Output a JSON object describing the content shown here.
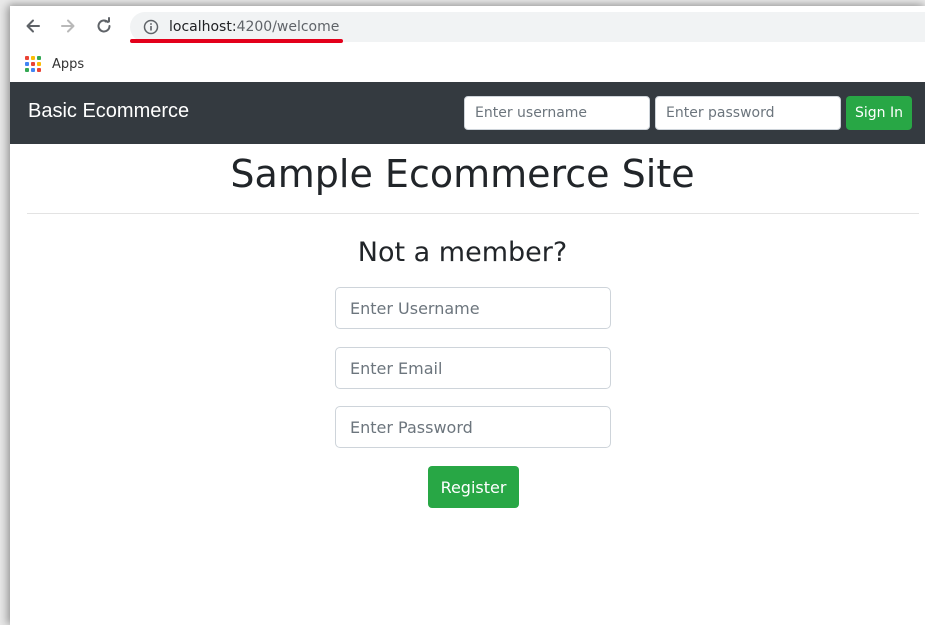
{
  "browser": {
    "url_host": "localhost:",
    "url_rest": "4200/welcome",
    "bookmarks": [
      {
        "label": "Apps"
      }
    ],
    "icons": {
      "back": "arrow-left-icon",
      "forward": "arrow-right-icon",
      "reload": "reload-icon",
      "site_info": "info-icon",
      "apps": "apps-grid-icon"
    },
    "apps_colors": [
      "#ea4335",
      "#fbbc05",
      "#34a853",
      "#4285f4",
      "#ea4335",
      "#fbbc05",
      "#34a853",
      "#4285f4",
      "#ea4335"
    ],
    "url_highlight_color": "#e3001b"
  },
  "navbar": {
    "brand": "Basic Ecommerce",
    "username_placeholder": "Enter username",
    "password_placeholder": "Enter password",
    "signin_label": "Sign In",
    "background_color": "#343a40"
  },
  "main": {
    "title": "Sample Ecommerce Site",
    "subtitle": "Not a member?",
    "username_placeholder": "Enter Username",
    "email_placeholder": "Enter Email",
    "password_placeholder": "Enter Password",
    "register_label": "Register",
    "button_color": "#28a745"
  }
}
